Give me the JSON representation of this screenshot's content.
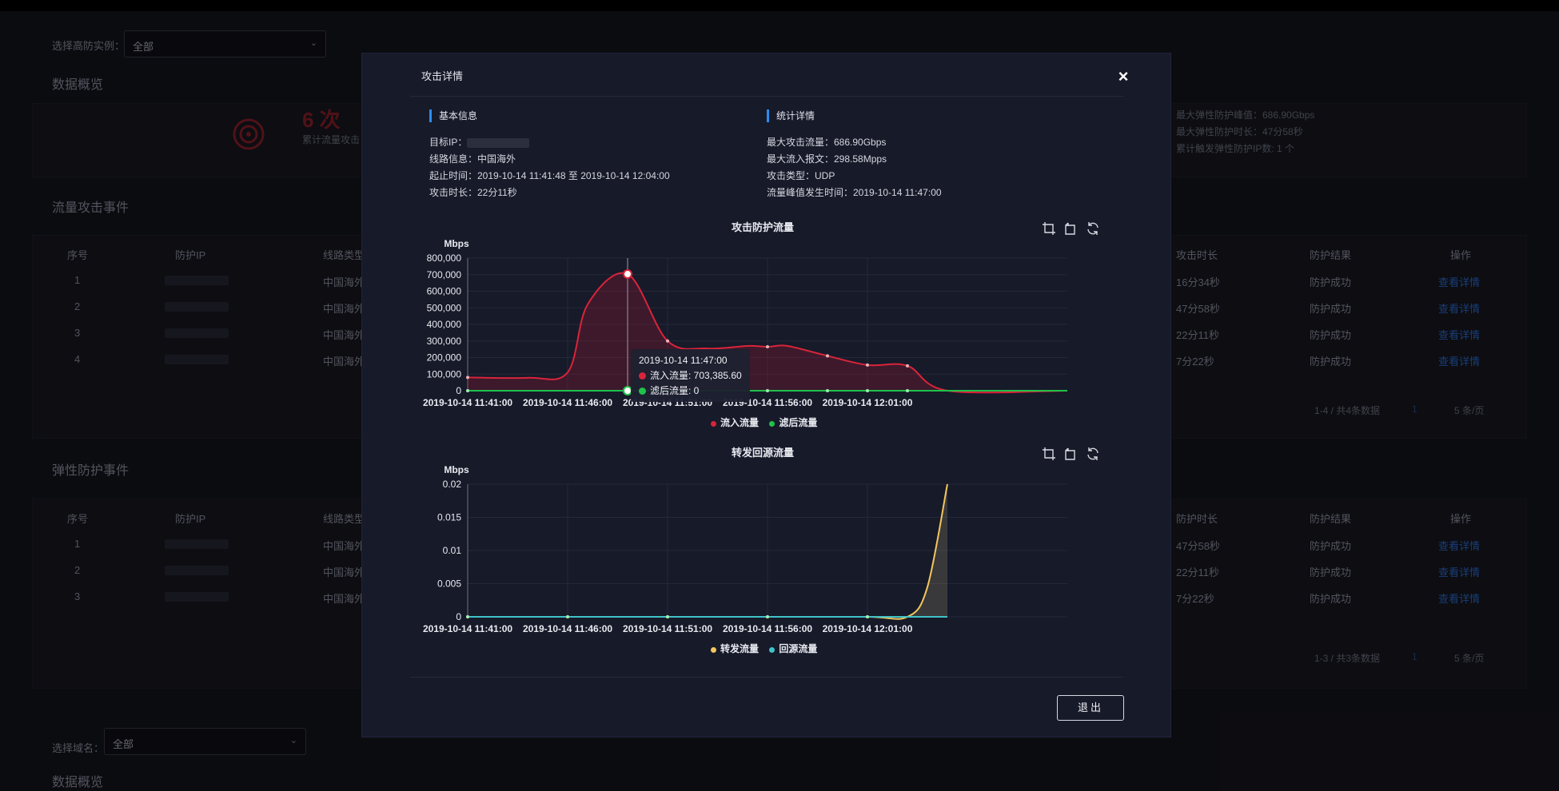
{
  "background": {
    "select_instance_label": "选择高防实例：",
    "select_instance_value": "全部",
    "overview_title": "数据概览",
    "attack_count": "6 次",
    "attack_count_label": "累计流量攻击",
    "elastic_stats": [
      "最大弹性防护峰值：686.90Gbps",
      "最大弹性防护时长：47分58秒",
      "累计触发弹性防护IP数: 1 个"
    ],
    "flow_events_title": "流量攻击事件",
    "flow_table_headers": [
      "序号",
      "防护IP",
      "线路类型",
      "攻击时长",
      "防护结果",
      "操作"
    ],
    "flow_rows": [
      {
        "idx": "1",
        "line": "中国海外",
        "dur": "16分34秒",
        "result": "防护成功",
        "op": "查看详情"
      },
      {
        "idx": "2",
        "line": "中国海外",
        "dur": "47分58秒",
        "result": "防护成功",
        "op": "查看详情"
      },
      {
        "idx": "3",
        "line": "中国海外",
        "dur": "22分11秒",
        "result": "防护成功",
        "op": "查看详情"
      },
      {
        "idx": "4",
        "line": "中国海外",
        "dur": "7分22秒",
        "result": "防护成功",
        "op": "查看详情"
      }
    ],
    "flow_pager": "1-4 / 共4条数据",
    "flow_page": "1",
    "flow_page_size": "5 条/页",
    "elastic_events_title": "弹性防护事件",
    "elastic_table_headers": [
      "序号",
      "防护IP",
      "线路类型",
      "防护时长",
      "防护结果",
      "操作"
    ],
    "elastic_rows": [
      {
        "idx": "1",
        "line": "中国海外",
        "dur": "47分58秒",
        "result": "防护成功",
        "op": "查看详情"
      },
      {
        "idx": "2",
        "line": "中国海外",
        "dur": "22分11秒",
        "result": "防护成功",
        "op": "查看详情"
      },
      {
        "idx": "3",
        "line": "中国海外",
        "dur": "7分22秒",
        "result": "防护成功",
        "op": "查看详情"
      }
    ],
    "elastic_pager": "1-3 / 共3条数据",
    "elastic_page": "1",
    "elastic_page_size": "5 条/页",
    "select_domain_label": "选择域名：",
    "select_domain_value": "全部",
    "overview_title_2": "数据概览"
  },
  "modal": {
    "title": "攻击详情",
    "close_glyph": "×",
    "basic_info_title": "基本信息",
    "target_ip_label": "目标IP：",
    "line_info": "线路信息：中国海外",
    "time_range": "起止时间：2019-10-14 11:41:48 至 2019-10-14 12:04:00",
    "duration": "攻击时长：22分11秒",
    "stats_title": "统计详情",
    "max_flow": "最大攻击流量：686.90Gbps",
    "max_packets": "最大流入报文：298.58Mpps",
    "attack_type": "攻击类型：UDP",
    "peak_time": "流量峰值发生时间：2019-10-14 11:47:00",
    "exit_label": "退出"
  },
  "colors": {
    "inflow": "#d9243a",
    "filtered": "#1fc24a",
    "forward": "#f2c75c",
    "origin": "#3fc3c8",
    "accent": "#2d8cf0"
  },
  "chart_data": [
    {
      "type": "area",
      "title": "攻击防护流量",
      "ylabel": "Mbps",
      "ylim": [
        0,
        800000
      ],
      "yticks": [
        "800,000",
        "700,000",
        "600,000",
        "500,000",
        "400,000",
        "300,000",
        "200,000",
        "100,000",
        "0"
      ],
      "xticks": [
        "2019-10-14 11:41:00",
        "2019-10-14 11:46:00",
        "2019-10-14 11:51:00",
        "2019-10-14 11:56:00",
        "2019-10-14 12:01:00"
      ],
      "x_minutes": [
        0,
        3,
        5,
        6,
        8,
        10,
        12,
        14,
        15,
        16,
        18,
        20,
        22,
        24,
        30
      ],
      "series": [
        {
          "name": "流入流量",
          "values": [
            80000,
            78000,
            110000,
            520000,
            703385,
            300000,
            255000,
            270000,
            265000,
            270000,
            210000,
            155000,
            150000,
            0,
            0
          ]
        },
        {
          "name": "滤后流量",
          "values": [
            0,
            0,
            0,
            0,
            0,
            0,
            0,
            0,
            0,
            0,
            0,
            0,
            0,
            0,
            0
          ]
        }
      ],
      "tooltip": {
        "time": "2019-10-14 11:47:00",
        "inflow": "流入流量: 703,385.60",
        "filtered": "滤后流量: 0"
      },
      "legend": [
        "流入流量",
        "滤后流量"
      ]
    },
    {
      "type": "area",
      "title": "转发回源流量",
      "ylabel": "Mbps",
      "ylim": [
        0,
        0.02
      ],
      "yticks": [
        "0.02",
        "0.015",
        "0.01",
        "0.005",
        "0"
      ],
      "xticks": [
        "2019-10-14 11:41:00",
        "2019-10-14 11:46:00",
        "2019-10-14 11:51:00",
        "2019-10-14 11:56:00",
        "2019-10-14 12:01:00"
      ],
      "x_minutes": [
        0,
        5,
        10,
        15,
        20,
        22,
        23,
        24
      ],
      "series": [
        {
          "name": "转发流量",
          "values": [
            0,
            0,
            0,
            0,
            0,
            0,
            0.0045,
            0.02
          ]
        },
        {
          "name": "回源流量",
          "values": [
            0,
            0,
            0,
            0,
            0,
            0,
            0,
            0
          ]
        }
      ],
      "legend": [
        "转发流量",
        "回源流量"
      ]
    }
  ]
}
